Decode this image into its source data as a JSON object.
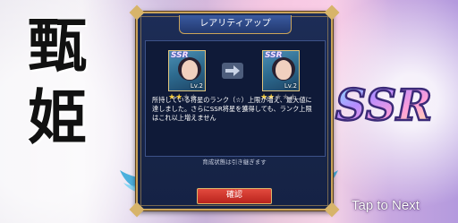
{
  "side_title": [
    "甄",
    "姫"
  ],
  "ssr_logo": "SSR",
  "tap_hint": "Tap to Next",
  "dialog": {
    "title": "レアリティアップ",
    "before_card": {
      "rarity": "SSR",
      "level": "Lv.2",
      "stars_filled": 2,
      "stars_total": 4
    },
    "after_card": {
      "rarity": "SSR",
      "level": "Lv.2",
      "stars_filled": 2,
      "stars_total": 5
    },
    "description": "所持している将星のランク（☆）上限が増え、最大値に達しました。さらにSSR将星を獲得しても、ランク上限はこれ以上増えません",
    "note": "育成状態は引き継ぎます",
    "confirm_label": "確認"
  },
  "colors": {
    "confirm": "#c82a22",
    "dialog_bg": "#1a2a52",
    "gold": "#c9a35a",
    "star_on": "#f1c93b",
    "star_off": "#6b6f7c"
  }
}
